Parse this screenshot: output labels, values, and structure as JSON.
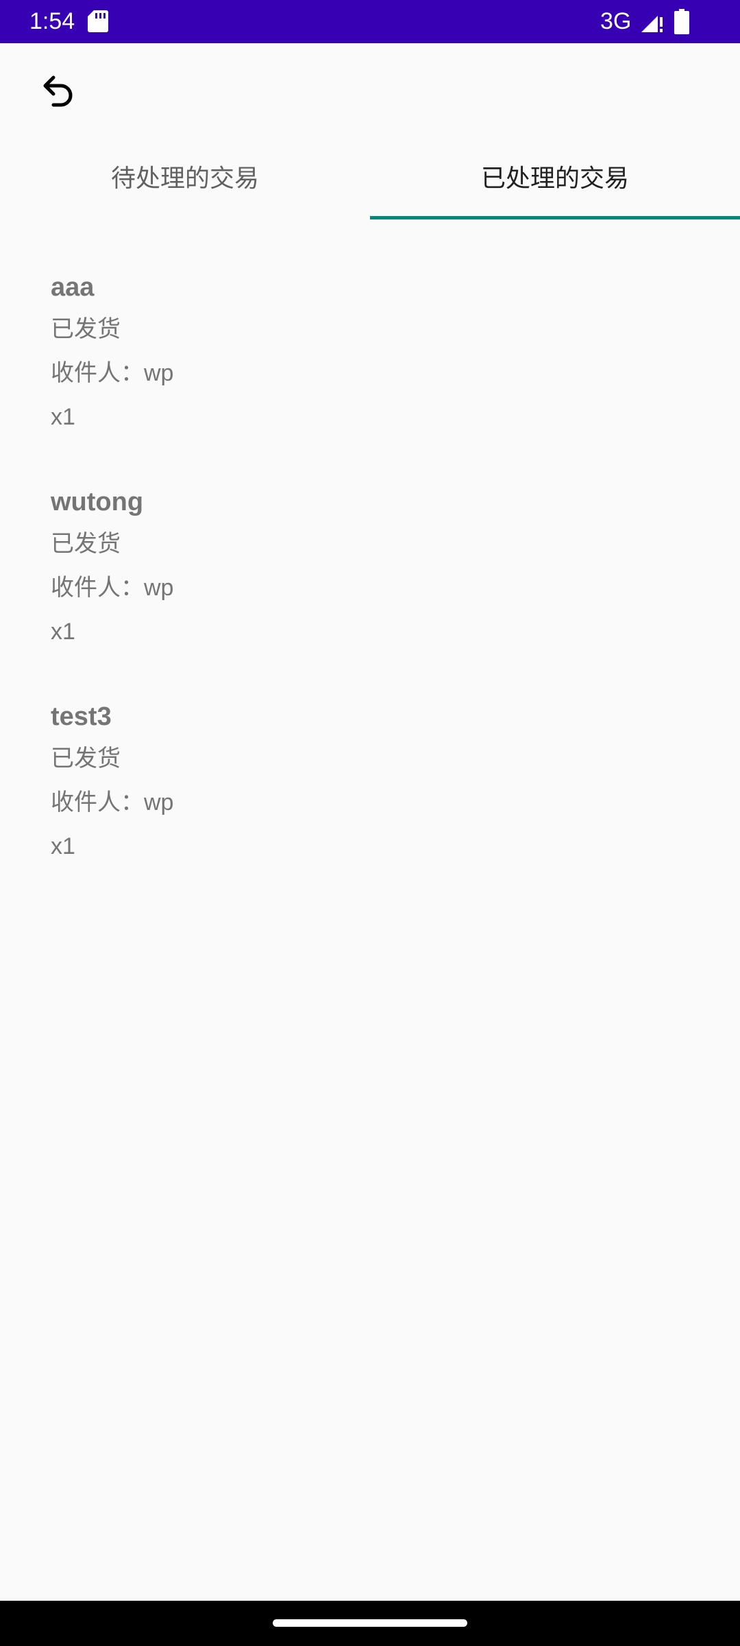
{
  "status_bar": {
    "time": "1:54",
    "network": "3G",
    "icons": [
      "sd-card-icon",
      "signal-icon",
      "battery-icon"
    ]
  },
  "toolbar": {
    "back_icon": "undo-arrow-icon"
  },
  "tabs": [
    {
      "label": "待处理的交易",
      "active": false
    },
    {
      "label": "已处理的交易",
      "active": true
    }
  ],
  "orders": [
    {
      "name": "aaa",
      "status": "已发货",
      "recipient": "收件人：wp",
      "quantity": "x1"
    },
    {
      "name": "wutong",
      "status": "已发货",
      "recipient": "收件人：wp",
      "quantity": "x1"
    },
    {
      "name": "test3",
      "status": "已发货",
      "recipient": "收件人：wp",
      "quantity": "x1"
    }
  ],
  "colors": {
    "status_bar": "#3700b3",
    "background": "#fafafa",
    "tab_indicator": "#00897b",
    "secondary_text": "#757575"
  }
}
